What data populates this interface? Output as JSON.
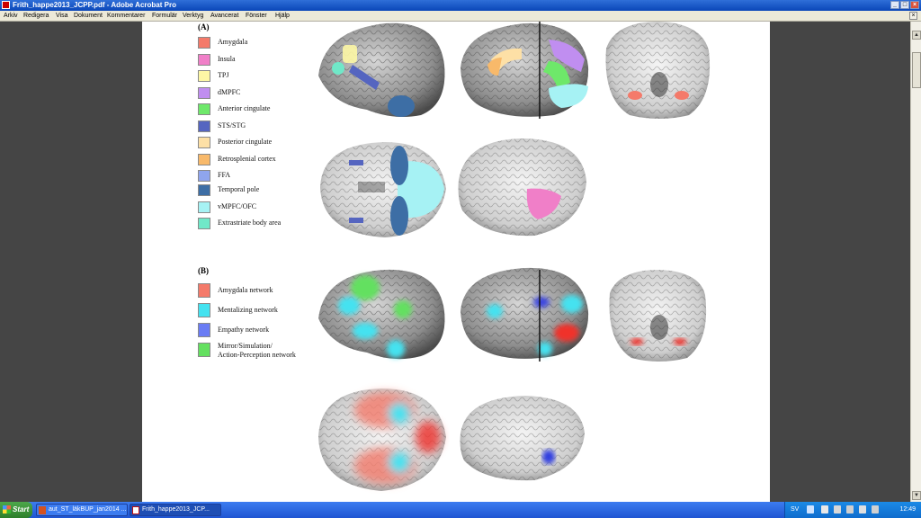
{
  "window": {
    "title": "Frith_happe2013_JCPP.pdf - Adobe Acrobat Pro",
    "controls": [
      "_",
      "□",
      "×"
    ]
  },
  "menu": {
    "items": [
      "Arkiv",
      "Redigera",
      "Visa",
      "Dokument",
      "Kommentarer",
      "Formulär",
      "Verktyg",
      "Avancerat",
      "Fönster",
      "Hjälp"
    ],
    "close": "×"
  },
  "figure": {
    "section_a": {
      "label": "(A)",
      "legend": [
        {
          "label": "Amygdala",
          "color": "#f47a6a"
        },
        {
          "label": "Insula",
          "color": "#f07fc8"
        },
        {
          "label": "TPJ",
          "color": "#fdf7a5"
        },
        {
          "label": "dMPFC",
          "color": "#c08ef0"
        },
        {
          "label": "Anterior cingulate",
          "color": "#6ee86a"
        },
        {
          "label": "STS/STG",
          "color": "#5565c0"
        },
        {
          "label": "Posterior cingulate",
          "color": "#fde0a6"
        },
        {
          "label": "Retrosplenial cortex",
          "color": "#f8b96a"
        },
        {
          "label": "FFA",
          "color": "#8fa5ee"
        },
        {
          "label": "Temporal pole",
          "color": "#3d6ea5"
        },
        {
          "label": "vMPFC/OFC",
          "color": "#a6f2f4"
        },
        {
          "label": "Extrastriate body area",
          "color": "#70e8c8"
        }
      ]
    },
    "section_b": {
      "label": "(B)",
      "legend": [
        {
          "label": "Amygdala network",
          "color": "#f47a6a"
        },
        {
          "label": "Mentalizing network",
          "color": "#44e2f0"
        },
        {
          "label": "Empathy network",
          "color": "#6a7cf4"
        },
        {
          "label": "Mirror/Simulation/",
          "label2": "Action-Perception network",
          "color": "#64e060"
        }
      ]
    }
  },
  "taskbar": {
    "start": "Start",
    "tasks": [
      {
        "label": "aut_ST_läkBUP_jan2014 ...",
        "icon_color": "#d4521f"
      },
      {
        "label": "Frith_happe2013_JCP...",
        "icon_color": "#c01010"
      }
    ],
    "tray": {
      "language": "SV",
      "time": "12:49"
    }
  }
}
